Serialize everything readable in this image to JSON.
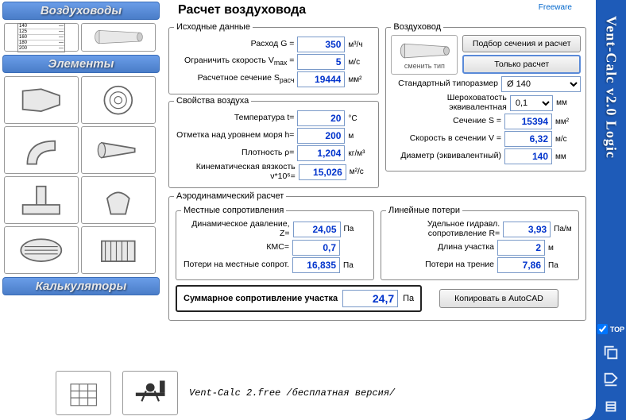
{
  "app_title": "Vent-Calc v2.0 Logic",
  "freeware": "Freeware",
  "sidebar": {
    "ducts_hdr": "Воздуховоды",
    "elements_hdr": "Элементы",
    "calcs_hdr": "Калькуляторы"
  },
  "title": "Расчет воздуховода",
  "input": {
    "legend": "Исходные данные",
    "flow_lbl": "Расход G =",
    "flow_val": "350",
    "flow_unit": "м³/ч",
    "vmax_lbl": "Ограничить скорость V",
    "vmax_sub": "max",
    "vmax_eq": " =",
    "vmax_val": "5",
    "vmax_unit": "м/с",
    "sect_lbl": "Расчетное сечение S",
    "sect_sub": "расч",
    "sect_val": "19444",
    "sect_unit": "мм²"
  },
  "air": {
    "legend": "Свойства воздуха",
    "temp_lbl": "Температура t=",
    "temp_val": "20",
    "temp_unit": "°C",
    "alt_lbl": "Отметка над уровнем моря h=",
    "alt_val": "200",
    "alt_unit": "м",
    "dens_lbl": "Плотность ρ=",
    "dens_val": "1,204",
    "dens_unit": "кг/м³",
    "visc_lbl": "Кинематическая вязкость ν*10⁶=",
    "visc_val": "15,026",
    "visc_unit": "м²/с"
  },
  "duct": {
    "legend": "Воздуховод",
    "change_type": "сменить тип",
    "btn_pick": "Подбор сечения и расчет",
    "btn_calc": "Только расчет",
    "size_lbl": "Стандартный типоразмер",
    "size_val": "Ø 140",
    "rough_lbl": "Шероховатость эквивалентная",
    "rough_val": "0,1",
    "rough_unit": "мм",
    "s_lbl": "Сечение S =",
    "s_val": "15394",
    "s_unit": "мм²",
    "v_lbl": "Скорость в сечении V =",
    "v_val": "6,32",
    "v_unit": "м/с",
    "d_lbl": "Диаметр (эквивалентный)",
    "d_val": "140",
    "d_unit": "мм"
  },
  "aero": {
    "legend": "Аэродинамический расчет",
    "local": {
      "legend": "Местные сопротивления",
      "z_lbl": "Динамическое давление, Z=",
      "z_val": "24,05",
      "z_unit": "Па",
      "kmc_lbl": "КМС=",
      "kmc_val": "0,7",
      "loss_lbl": "Потери на местные сопрот.",
      "loss_val": "16,835",
      "loss_unit": "Па"
    },
    "linear": {
      "legend": "Линейные потери",
      "r_lbl": "Удельное гидравл. сопротивление R=",
      "r_val": "3,93",
      "r_unit": "Па/м",
      "len_lbl": "Длина участка",
      "len_val": "2",
      "len_unit": "м",
      "fric_lbl": "Потери на трение",
      "fric_val": "7,86",
      "fric_unit": "Па"
    }
  },
  "sum": {
    "lbl": "Суммарное сопротивление участка",
    "val": "24,7",
    "unit": "Па"
  },
  "copy_btn": "Копировать в AutoCAD",
  "footer": "Vent-Calc 2.free /бесплатная версия/",
  "top_chk": "TOP"
}
